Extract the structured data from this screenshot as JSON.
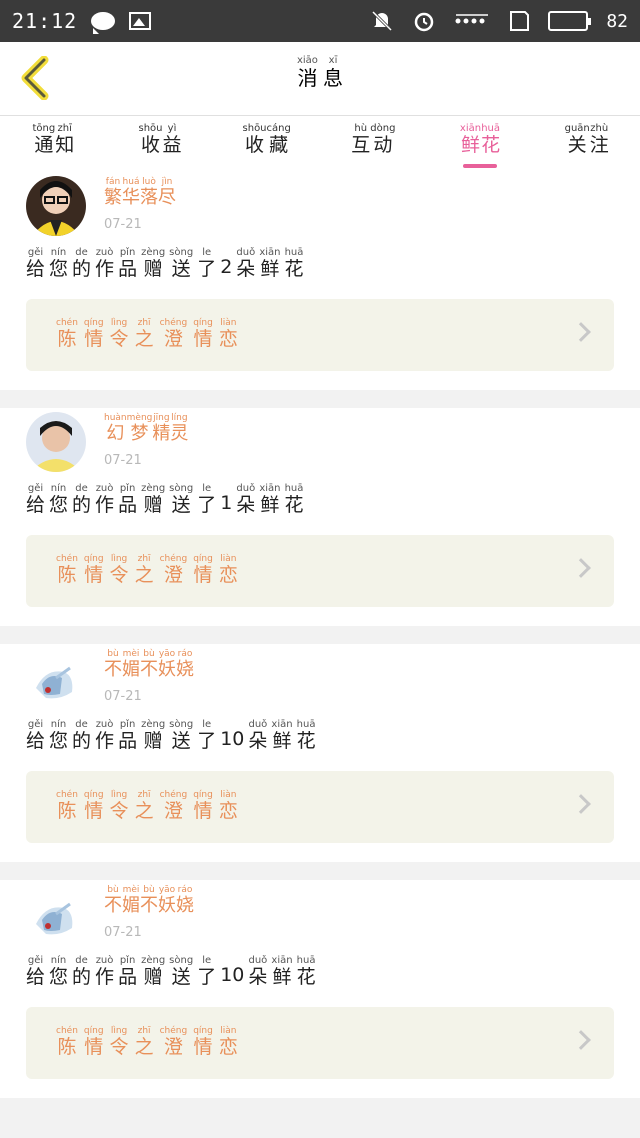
{
  "status_bar": {
    "time": "21:12",
    "battery": "82",
    "battery_level": 0.82
  },
  "header": {
    "title": [
      {
        "py": "xiāo",
        "hz": "消"
      },
      {
        "py": "xī",
        "hz": "息"
      }
    ]
  },
  "tabs": [
    {
      "words": [
        {
          "py": "tōng",
          "hz": "通"
        },
        {
          "py": "zhī",
          "hz": "知"
        }
      ],
      "active": false
    },
    {
      "words": [
        {
          "py": "shōu",
          "hz": "收"
        },
        {
          "py": "yì",
          "hz": "益"
        }
      ],
      "active": false
    },
    {
      "words": [
        {
          "py": "shōu",
          "hz": "收"
        },
        {
          "py": "cáng",
          "hz": "藏"
        }
      ],
      "active": false
    },
    {
      "words": [
        {
          "py": "hù",
          "hz": "互"
        },
        {
          "py": "dòng",
          "hz": "动"
        }
      ],
      "active": false
    },
    {
      "words": [
        {
          "py": "xiān",
          "hz": "鲜"
        },
        {
          "py": "huā",
          "hz": "花"
        }
      ],
      "active": true
    },
    {
      "words": [
        {
          "py": "guān",
          "hz": "关"
        },
        {
          "py": "zhù",
          "hz": "注"
        }
      ],
      "active": false
    }
  ],
  "cards": [
    {
      "avatar": "avatar-woman-glasses",
      "username": [
        {
          "py": "fán",
          "hz": "繁"
        },
        {
          "py": "huá",
          "hz": "华"
        },
        {
          "py": "luò",
          "hz": "落"
        },
        {
          "py": "jìn",
          "hz": "尽"
        }
      ],
      "date": "07-21",
      "count": "2",
      "work": [
        {
          "py": "chén",
          "hz": "陈"
        },
        {
          "py": "qíng",
          "hz": "情"
        },
        {
          "py": "lìng",
          "hz": "令"
        },
        {
          "py": "zhī",
          "hz": "之"
        },
        {
          "py": "chéng",
          "hz": "澄"
        },
        {
          "py": "qíng",
          "hz": "情"
        },
        {
          "py": "liàn",
          "hz": "恋"
        }
      ]
    },
    {
      "avatar": "avatar-woman-yellow",
      "username": [
        {
          "py": "huàn",
          "hz": "幻"
        },
        {
          "py": "mèng",
          "hz": "梦"
        },
        {
          "py": "jīng",
          "hz": "精"
        },
        {
          "py": "líng",
          "hz": "灵"
        }
      ],
      "date": "07-21",
      "count": "1",
      "work": [
        {
          "py": "chén",
          "hz": "陈"
        },
        {
          "py": "qíng",
          "hz": "情"
        },
        {
          "py": "lìng",
          "hz": "令"
        },
        {
          "py": "zhī",
          "hz": "之"
        },
        {
          "py": "chéng",
          "hz": "澄"
        },
        {
          "py": "qíng",
          "hz": "情"
        },
        {
          "py": "liàn",
          "hz": "恋"
        }
      ]
    },
    {
      "avatar": "avatar-anime",
      "username": [
        {
          "py": "bù",
          "hz": "不"
        },
        {
          "py": "mèi",
          "hz": "媚"
        },
        {
          "py": "bù",
          "hz": "不"
        },
        {
          "py": "yāo",
          "hz": "妖"
        },
        {
          "py": "ráo",
          "hz": "娆"
        }
      ],
      "date": "07-21",
      "count": "10",
      "work": [
        {
          "py": "chén",
          "hz": "陈"
        },
        {
          "py": "qíng",
          "hz": "情"
        },
        {
          "py": "lìng",
          "hz": "令"
        },
        {
          "py": "zhī",
          "hz": "之"
        },
        {
          "py": "chéng",
          "hz": "澄"
        },
        {
          "py": "qíng",
          "hz": "情"
        },
        {
          "py": "liàn",
          "hz": "恋"
        }
      ]
    },
    {
      "avatar": "avatar-anime",
      "username": [
        {
          "py": "bù",
          "hz": "不"
        },
        {
          "py": "mèi",
          "hz": "媚"
        },
        {
          "py": "bù",
          "hz": "不"
        },
        {
          "py": "yāo",
          "hz": "妖"
        },
        {
          "py": "ráo",
          "hz": "娆"
        }
      ],
      "date": "07-21",
      "count": "10",
      "work": [
        {
          "py": "chén",
          "hz": "陈"
        },
        {
          "py": "qíng",
          "hz": "情"
        },
        {
          "py": "lìng",
          "hz": "令"
        },
        {
          "py": "zhī",
          "hz": "之"
        },
        {
          "py": "chéng",
          "hz": "澄"
        },
        {
          "py": "qíng",
          "hz": "情"
        },
        {
          "py": "liàn",
          "hz": "恋"
        }
      ]
    }
  ],
  "message": {
    "before": [
      {
        "py": "gěi",
        "hz": "给"
      },
      {
        "py": "nín",
        "hz": "您"
      },
      {
        "py": "de",
        "hz": "的"
      },
      {
        "py": "zuò",
        "hz": "作"
      },
      {
        "py": "pǐn",
        "hz": "品"
      },
      {
        "py": "zèng",
        "hz": "赠"
      },
      {
        "py": "sòng",
        "hz": "送"
      },
      {
        "py": "le",
        "hz": "了"
      }
    ],
    "after": [
      {
        "py": "duǒ",
        "hz": "朵"
      },
      {
        "py": "xiān",
        "hz": "鲜"
      },
      {
        "py": "huā",
        "hz": "花"
      }
    ]
  }
}
